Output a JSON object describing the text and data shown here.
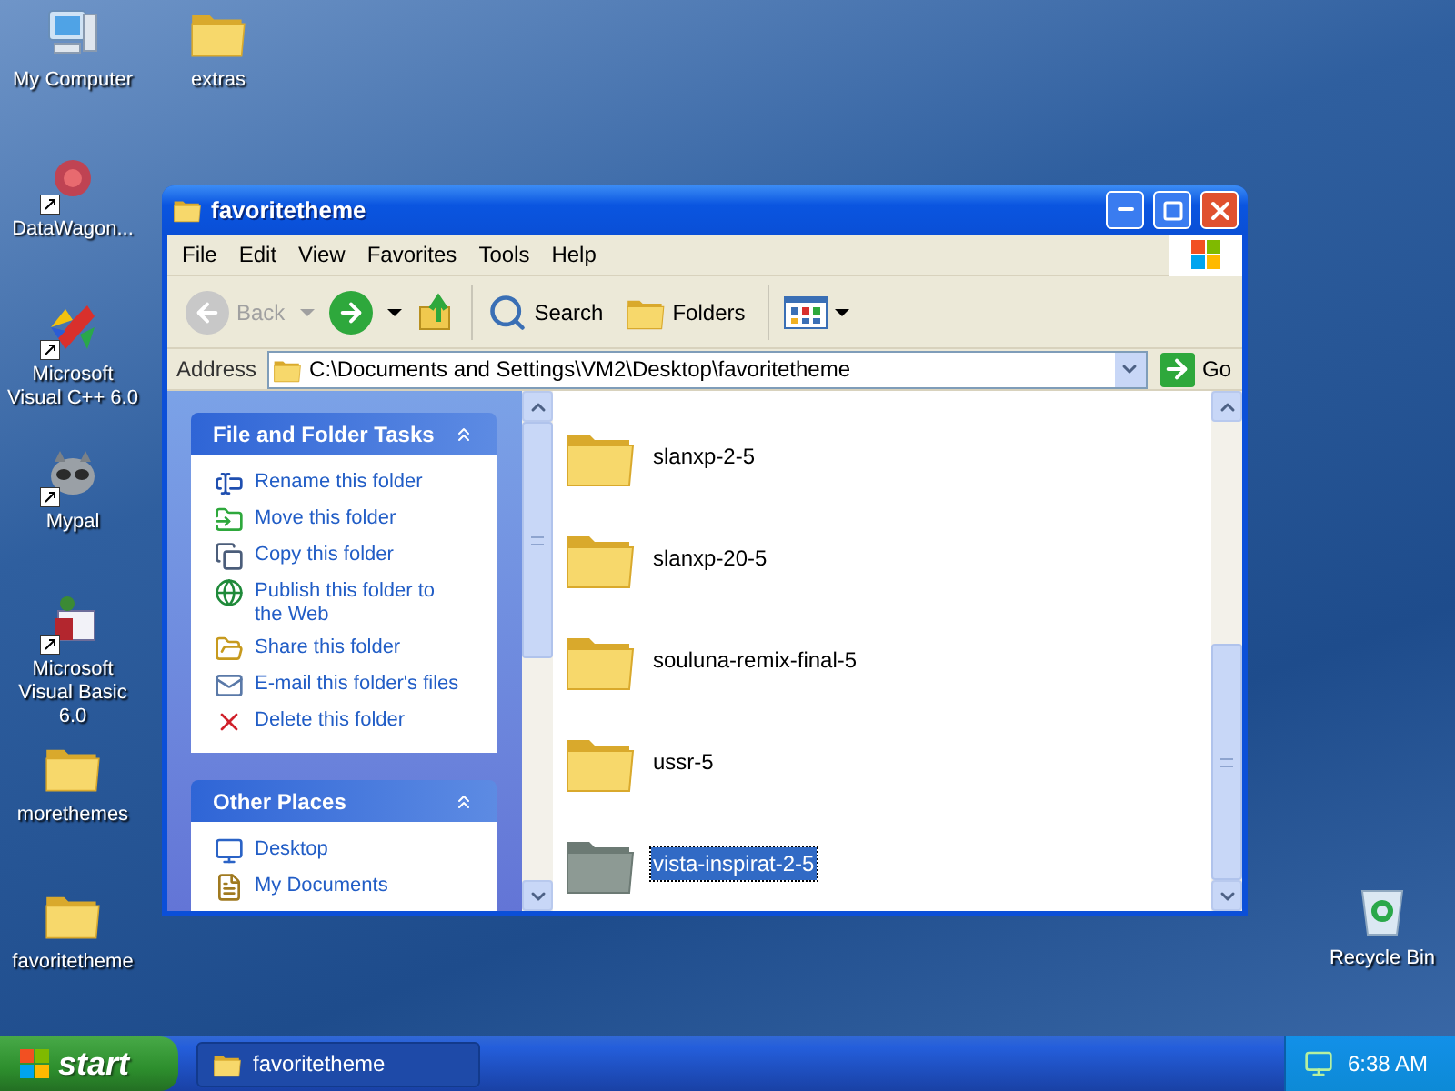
{
  "desktop_icons": [
    {
      "label": "My Computer",
      "kind": "computer",
      "shortcut": false
    },
    {
      "label": "extras",
      "kind": "folder",
      "shortcut": false
    },
    {
      "label": "DataWagon...",
      "kind": "burst",
      "shortcut": true
    },
    {
      "label": "Microsoft Visual C++ 6.0",
      "kind": "ide",
      "shortcut": true
    },
    {
      "label": "Mypal",
      "kind": "mascot",
      "shortcut": true
    },
    {
      "label": "Microsoft Visual Basic 6.0",
      "kind": "basic",
      "shortcut": true
    },
    {
      "label": "morethemes",
      "kind": "folder",
      "shortcut": false
    },
    {
      "label": "favoritetheme",
      "kind": "folder",
      "shortcut": false
    },
    {
      "label": "Recycle Bin",
      "kind": "recycle",
      "shortcut": false
    }
  ],
  "window": {
    "title": "favoritetheme",
    "menu": [
      "File",
      "Edit",
      "View",
      "Favorites",
      "Tools",
      "Help"
    ],
    "toolbar": [
      {
        "kind": "back",
        "label": "Back",
        "disabled": true
      },
      {
        "kind": "forward",
        "disabled": false
      },
      {
        "kind": "up",
        "disabled": false
      },
      {
        "kind": "search",
        "label": "Search",
        "disabled": false
      },
      {
        "kind": "folders",
        "label": "Folders",
        "disabled": false
      },
      {
        "kind": "views",
        "disabled": false
      }
    ],
    "address": {
      "label": "Address",
      "value": "C:\\Documents and Settings\\VM2\\Desktop\\favoritetheme",
      "go": "Go"
    },
    "task_panels": [
      {
        "title": "File and Folder Tasks",
        "expanded": true,
        "items": [
          {
            "kind": "rename",
            "label": "Rename this folder"
          },
          {
            "kind": "move",
            "label": "Move this folder"
          },
          {
            "kind": "copy",
            "label": "Copy this folder"
          },
          {
            "kind": "publish",
            "label": "Publish this folder to the Web"
          },
          {
            "kind": "share",
            "label": "Share this folder"
          },
          {
            "kind": "email",
            "label": "E-mail this folder's files"
          },
          {
            "kind": "delete",
            "label": "Delete this folder"
          }
        ]
      },
      {
        "title": "Other Places",
        "expanded": true,
        "items": [
          {
            "kind": "desktop",
            "label": "Desktop"
          },
          {
            "kind": "documents",
            "label": "My Documents"
          }
        ]
      }
    ],
    "files": [
      {
        "name": "slanxp-2-5",
        "selected": false
      },
      {
        "name": "slanxp-20-5",
        "selected": false
      },
      {
        "name": "souluna-remix-final-5",
        "selected": false
      },
      {
        "name": "ussr-5",
        "selected": false
      },
      {
        "name": "vista-inspirat-2-5",
        "selected": true
      }
    ]
  },
  "taskbar": {
    "start": "start",
    "tasks": [
      {
        "label": "favoritetheme",
        "selected": true
      }
    ],
    "clock": "6:38 AM"
  }
}
